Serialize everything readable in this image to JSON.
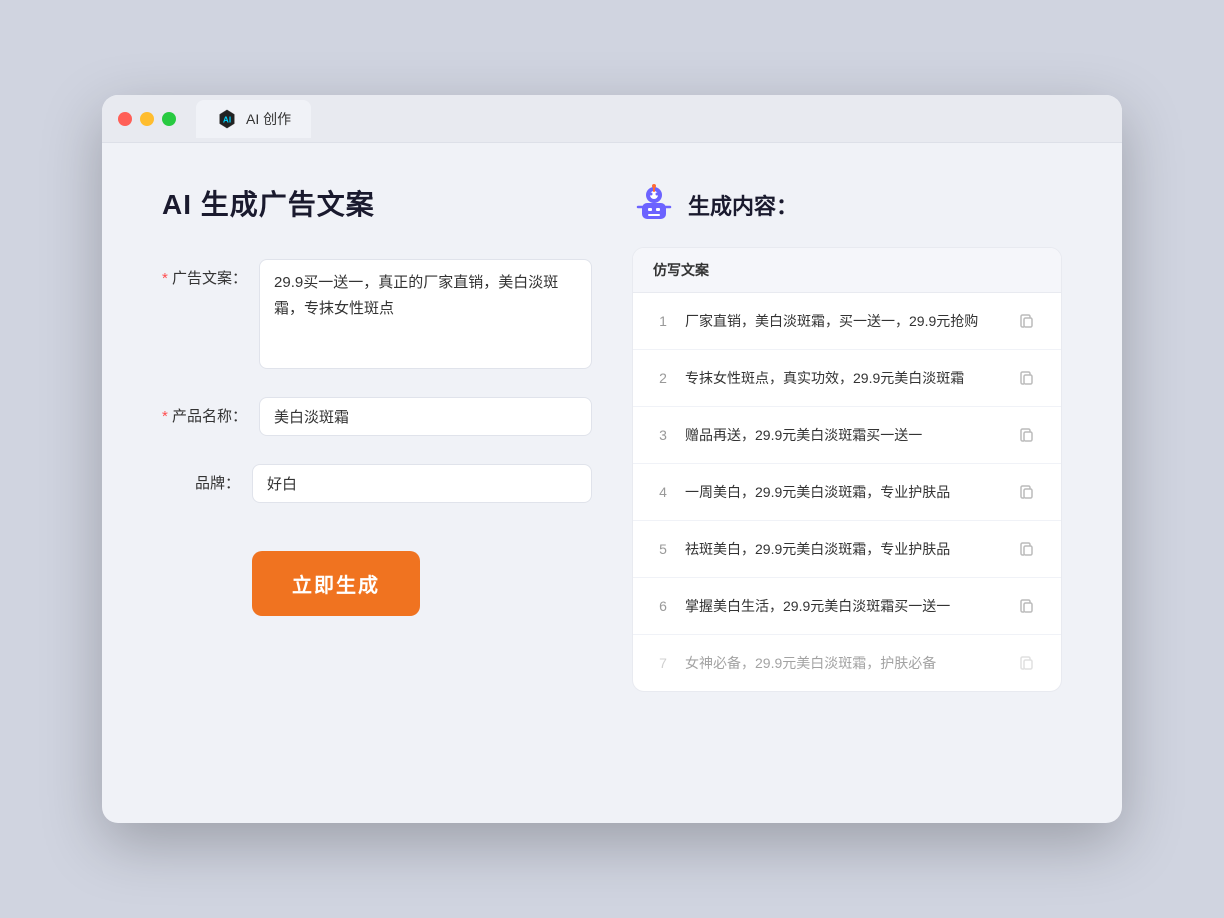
{
  "browser": {
    "tab_label": "AI 创作"
  },
  "page": {
    "title": "AI 生成广告文案",
    "result_title": "生成内容："
  },
  "form": {
    "ad_copy_label": "广告文案：",
    "ad_copy_value": "29.9买一送一，真正的厂家直销，美白淡斑霜，专抹女性斑点",
    "product_name_label": "产品名称：",
    "product_name_value": "美白淡斑霜",
    "brand_label": "品牌：",
    "brand_value": "好白",
    "generate_button": "立即生成"
  },
  "results": {
    "column_header": "仿写文案",
    "items": [
      {
        "id": 1,
        "text": "厂家直销，美白淡斑霜，买一送一，29.9元抢购",
        "faded": false
      },
      {
        "id": 2,
        "text": "专抹女性斑点，真实功效，29.9元美白淡斑霜",
        "faded": false
      },
      {
        "id": 3,
        "text": "赠品再送，29.9元美白淡斑霜买一送一",
        "faded": false
      },
      {
        "id": 4,
        "text": "一周美白，29.9元美白淡斑霜，专业护肤品",
        "faded": false
      },
      {
        "id": 5,
        "text": "祛斑美白，29.9元美白淡斑霜，专业护肤品",
        "faded": false
      },
      {
        "id": 6,
        "text": "掌握美白生活，29.9元美白淡斑霜买一送一",
        "faded": false
      },
      {
        "id": 7,
        "text": "女神必备，29.9元美白淡斑霜，护肤必备",
        "faded": true
      }
    ]
  }
}
